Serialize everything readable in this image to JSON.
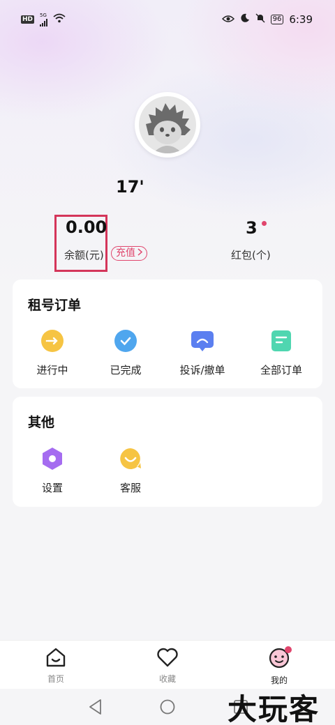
{
  "status_bar": {
    "hd": "HD",
    "network": "5G",
    "battery": "96",
    "time": "6:39"
  },
  "profile": {
    "username": "17'"
  },
  "stats": {
    "balance_value": "0.00",
    "balance_label": "余额(元)",
    "recharge_label": "充值",
    "coupon_value": "3",
    "coupon_label": "红包(个)"
  },
  "orders_card": {
    "title": "租号订单",
    "items": [
      {
        "label": "进行中",
        "icon": "in-progress-icon",
        "color": "#f6c443"
      },
      {
        "label": "已完成",
        "icon": "completed-check-icon",
        "color": "#4fa6ee"
      },
      {
        "label": "投诉/撤单",
        "icon": "complaint-icon",
        "color": "#5b7ff0"
      },
      {
        "label": "全部订单",
        "icon": "all-orders-icon",
        "color": "#4fd6b0"
      }
    ]
  },
  "other_card": {
    "title": "其他",
    "items": [
      {
        "label": "设置",
        "icon": "settings-hexagon-icon",
        "color": "#a56cf0"
      },
      {
        "label": "客服",
        "icon": "customer-service-icon",
        "color": "#f6c443"
      }
    ]
  },
  "tabbar": {
    "tabs": [
      {
        "label": "首页",
        "icon": "home-icon"
      },
      {
        "label": "收藏",
        "icon": "heart-icon"
      },
      {
        "label": "我的",
        "icon": "mine-avatar-icon"
      }
    ]
  },
  "watermark": "大玩客",
  "colors": {
    "accent": "#e0456c",
    "highlight_box": "#d4355a"
  }
}
